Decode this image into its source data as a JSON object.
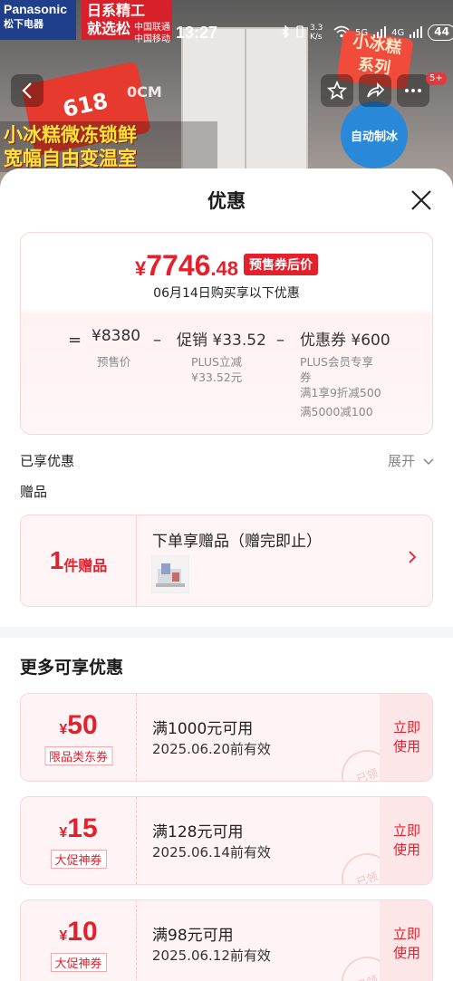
{
  "status_bar": {
    "carrier1": "中国联通",
    "carrier2": "中国移动",
    "time": "13:27",
    "net_speed": "3.3 K/s",
    "signal1": "5G",
    "signal2": "4G",
    "battery": "44"
  },
  "background": {
    "brand_en": "Panasonic",
    "brand_cn": "松下电器",
    "promo_line1": "日系精工",
    "promo_line2": "就选松",
    "sale": "618",
    "temp": "0CM",
    "slogan_line1": "小冰糕微冻锁鲜",
    "slogan_line2": "宽幅自由变温室",
    "series_line1": "小冰糕",
    "series_line2": "系列",
    "ice_text": "自动制冰"
  },
  "nav": {
    "badge": "5+"
  },
  "sheet": {
    "title": "优惠"
  },
  "price_card": {
    "currency": "¥",
    "final_int": "7746",
    "final_dec": ".48",
    "final_tag": "预售券后价",
    "final_sub": "06月14日购买享以下优惠",
    "op_equal": "=",
    "presale_price": "¥8380",
    "presale_label": "预售价",
    "op_minus1": "–",
    "promo_price": "促销 ¥33.52",
    "promo_sub1": "PLUS立减",
    "promo_sub2": "¥33.52元",
    "op_minus2": "–",
    "coupon_price": "优惠券 ¥600",
    "coupon_sub1": "PLUS会员专享",
    "coupon_sub2": "券",
    "coupon_sub3": "满1享9折减500",
    "coupon_sub4": "满5000减100"
  },
  "enjoyed": {
    "label": "已享优惠",
    "expand": "展开",
    "gift_label": "赠品"
  },
  "gift": {
    "count": "1",
    "count_label": "件赠品",
    "title": "下单享赠品（赠完即止）"
  },
  "more": {
    "title": "更多可享优惠"
  },
  "coupons": [
    {
      "currency": "¥",
      "amount": "50",
      "tag": "限品类东券",
      "cond": "满1000元可用",
      "expiry": "2025.06.20前有效",
      "use": "立即使用",
      "stamp": "已领"
    },
    {
      "currency": "¥",
      "amount": "15",
      "tag": "大促神券",
      "cond": "满128元可用",
      "expiry": "2025.06.14前有效",
      "use": "立即使用",
      "stamp": "已领"
    },
    {
      "currency": "¥",
      "amount": "10",
      "tag": "大促神券",
      "cond": "满98元可用",
      "expiry": "2025.06.12前有效",
      "use": "立即使用",
      "stamp": "已领"
    }
  ],
  "colors": {
    "accent": "#e4202d",
    "card_border": "#fad5d7",
    "card_bg": "#fff4f5"
  }
}
